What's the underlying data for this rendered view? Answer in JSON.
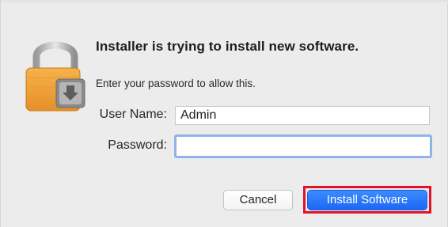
{
  "dialog": {
    "title": "Installer is trying to install new software.",
    "subtitle": "Enter your password to allow this."
  },
  "form": {
    "username_label": "User Name:",
    "username_value": "Admin",
    "password_label": "Password:",
    "password_value": ""
  },
  "buttons": {
    "cancel_label": "Cancel",
    "install_label": "Install Software"
  },
  "icons": {
    "lock": "lock-icon",
    "installer_badge": "installer-badge-icon"
  },
  "colors": {
    "primary_button": "#1c67f5",
    "highlight_outline": "#e3112a",
    "focus_ring": "#8fb4ea",
    "lock_body": "#f2a33a"
  }
}
